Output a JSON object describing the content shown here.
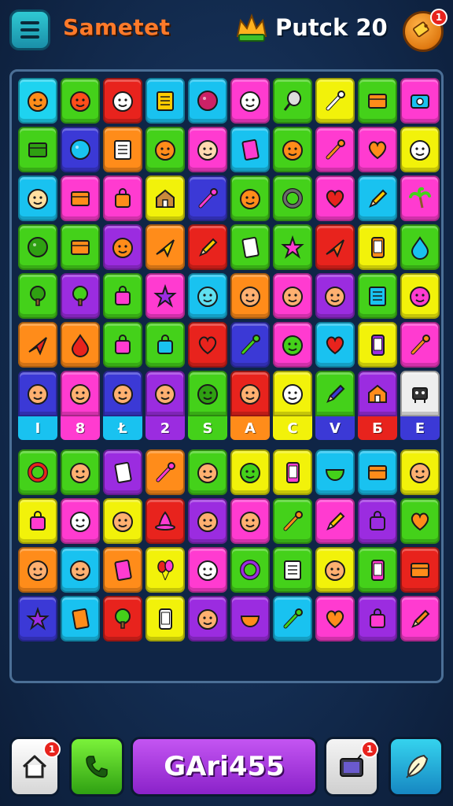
{
  "header": {
    "title": "Sametet",
    "score_label": "Putck 20",
    "notification_count": "1"
  },
  "board": {
    "rows": [
      [
        {
          "bg": "#1ed3f0",
          "icon": "face-icon",
          "fg": "#ff8c1a"
        },
        {
          "bg": "#44d11a",
          "icon": "face-icon",
          "fg": "#ff4d1a"
        },
        {
          "bg": "#e8231d",
          "icon": "face-icon",
          "fg": "#ffffff"
        },
        {
          "bg": "#19c2f0",
          "icon": "notebook-icon",
          "fg": "#ffcc00"
        },
        {
          "bg": "#19c2f0",
          "icon": "ball-icon",
          "fg": "#cc2266"
        },
        {
          "bg": "#ff3bd0",
          "icon": "face-icon",
          "fg": "#ffffff"
        },
        {
          "bg": "#44d11a",
          "icon": "racket-icon",
          "fg": "#dddddd"
        },
        {
          "bg": "#f2f20a",
          "icon": "tool-icon",
          "fg": "#ffffff"
        },
        {
          "bg": "#44d11a",
          "icon": "box-icon",
          "fg": "#ff8c1a"
        },
        {
          "bg": "#ff3bd0",
          "icon": "camera-icon",
          "fg": "#19c2f0"
        }
      ],
      [
        {
          "bg": "#44d11a",
          "icon": "box-icon",
          "fg": "#2fa012"
        },
        {
          "bg": "#3b39d6",
          "icon": "ball-icon",
          "fg": "#19c2f0"
        },
        {
          "bg": "#ff8c1a",
          "icon": "notebook-icon",
          "fg": "#ffffff"
        },
        {
          "bg": "#44d11a",
          "icon": "face-icon",
          "fg": "#ff8c1a"
        },
        {
          "bg": "#ff3bd0",
          "icon": "face-icon",
          "fg": "#ffd9b0"
        },
        {
          "bg": "#19c2f0",
          "icon": "card-icon",
          "fg": "#ff3bd0"
        },
        {
          "bg": "#44d11a",
          "icon": "face-icon",
          "fg": "#ff8c1a"
        },
        {
          "bg": "#ff3bd0",
          "icon": "tool-icon",
          "fg": "#ff8c1a"
        },
        {
          "bg": "#ff3bd0",
          "icon": "heart-icon",
          "fg": "#ff8c1a"
        },
        {
          "bg": "#f2f20a",
          "icon": "face-icon",
          "fg": "#ffffff"
        }
      ],
      [
        {
          "bg": "#19c2f0",
          "icon": "face-icon",
          "fg": "#ffe0a0"
        },
        {
          "bg": "#ff3bd0",
          "icon": "box-icon",
          "fg": "#ff8c1a"
        },
        {
          "bg": "#ff3bd0",
          "icon": "bag-icon",
          "fg": "#ff8c1a"
        },
        {
          "bg": "#f2f20a",
          "icon": "house-icon",
          "fg": "#c98a3c"
        },
        {
          "bg": "#3b39d6",
          "icon": "tool-icon",
          "fg": "#ff3bd0"
        },
        {
          "bg": "#44d11a",
          "icon": "face-icon",
          "fg": "#ff8c1a"
        },
        {
          "bg": "#44d11a",
          "icon": "ring-icon",
          "fg": "#6b6b6b"
        },
        {
          "bg": "#ff3bd0",
          "icon": "heart-icon",
          "fg": "#e8231d"
        },
        {
          "bg": "#19c2f0",
          "icon": "pencil-icon",
          "fg": "#ffcc00"
        },
        {
          "bg": "#ff3bd0",
          "icon": "palm-icon",
          "fg": "#44d11a"
        }
      ],
      [
        {
          "bg": "#44d11a",
          "icon": "ball-icon",
          "fg": "#2fa012"
        },
        {
          "bg": "#44d11a",
          "icon": "box-icon",
          "fg": "#ff8c1a"
        },
        {
          "bg": "#9b2ce0",
          "icon": "face-icon",
          "fg": "#ff8c1a"
        },
        {
          "bg": "#ff8c1a",
          "icon": "plane-icon",
          "fg": "#ffcc00"
        },
        {
          "bg": "#e8231d",
          "icon": "pencil-icon",
          "fg": "#ffcc00"
        },
        {
          "bg": "#44d11a",
          "icon": "card-icon",
          "fg": "#ffffff"
        },
        {
          "bg": "#44d11a",
          "icon": "star-icon",
          "fg": "#ff3bd0"
        },
        {
          "bg": "#e8231d",
          "icon": "plane-icon",
          "fg": "#ff6a1a"
        },
        {
          "bg": "#f2f20a",
          "icon": "phone-icon",
          "fg": "#ff8c1a"
        },
        {
          "bg": "#44d11a",
          "icon": "drop-icon",
          "fg": "#19c2f0"
        }
      ],
      [
        {
          "bg": "#44d11a",
          "icon": "tree-icon",
          "fg": "#2fa012"
        },
        {
          "bg": "#9b2ce0",
          "icon": "tree-icon",
          "fg": "#44d11a"
        },
        {
          "bg": "#44d11a",
          "icon": "bag-icon",
          "fg": "#ff3bd0"
        },
        {
          "bg": "#ff3bd0",
          "icon": "star-icon",
          "fg": "#9b2ce0"
        },
        {
          "bg": "#19c2f0",
          "icon": "face-icon",
          "fg": "#5fe0f0"
        },
        {
          "bg": "#ff8c1a",
          "icon": "face-icon",
          "fg": "#ffb070"
        },
        {
          "bg": "#ff3bd0",
          "icon": "face-icon",
          "fg": "#ffb070"
        },
        {
          "bg": "#9b2ce0",
          "icon": "face-icon",
          "fg": "#ffb070"
        },
        {
          "bg": "#44d11a",
          "icon": "notebook-icon",
          "fg": "#19c2f0"
        },
        {
          "bg": "#f2f20a",
          "icon": "face-icon",
          "fg": "#ff3bd0"
        }
      ],
      [
        {
          "bg": "#ff8c1a",
          "icon": "plane-icon",
          "fg": "#e8231d"
        },
        {
          "bg": "#ff8c1a",
          "icon": "drop-icon",
          "fg": "#e8231d"
        },
        {
          "bg": "#44d11a",
          "icon": "bag-icon",
          "fg": "#ff3bd0"
        },
        {
          "bg": "#44d11a",
          "icon": "bag-icon",
          "fg": "#19c2f0"
        },
        {
          "bg": "#e8231d",
          "icon": "heart-icon",
          "fg": "#e8231d"
        },
        {
          "bg": "#3b39d6",
          "icon": "tool-icon",
          "fg": "#44d11a"
        },
        {
          "bg": "#ff3bd0",
          "icon": "face-icon",
          "fg": "#44d11a"
        },
        {
          "bg": "#19c2f0",
          "icon": "heart-icon",
          "fg": "#e8231d"
        },
        {
          "bg": "#f2f20a",
          "icon": "phone-icon",
          "fg": "#9b2ce0"
        },
        {
          "bg": "#ff3bd0",
          "icon": "tool-icon",
          "fg": "#ff8c1a"
        }
      ],
      [
        {
          "bg": "#3b39d6",
          "icon": "face-icon",
          "fg": "#ffb070"
        },
        {
          "bg": "#ff3bd0",
          "icon": "face-icon",
          "fg": "#ffb070"
        },
        {
          "bg": "#3b39d6",
          "icon": "face-icon",
          "fg": "#ffb070"
        },
        {
          "bg": "#9b2ce0",
          "icon": "face-icon",
          "fg": "#ffb070"
        },
        {
          "bg": "#44d11a",
          "icon": "face-icon",
          "fg": "#2fa012"
        },
        {
          "bg": "#e8231d",
          "icon": "face-icon",
          "fg": "#ffb070"
        },
        {
          "bg": "#f2f20a",
          "icon": "face-icon",
          "fg": "#ffffff"
        },
        {
          "bg": "#44d11a",
          "icon": "pencil-icon",
          "fg": "#3b39d6"
        },
        {
          "bg": "#9b2ce0",
          "icon": "house-icon",
          "fg": "#ff8c1a"
        },
        {
          "bg": "#eeeeee",
          "icon": "robot-icon",
          "fg": "#333333"
        }
      ],
      [
        {
          "bg": "#44d11a",
          "icon": "ring-icon",
          "fg": "#e8231d"
        },
        {
          "bg": "#44d11a",
          "icon": "face-icon",
          "fg": "#ffb070"
        },
        {
          "bg": "#9b2ce0",
          "icon": "card-icon",
          "fg": "#ffffff"
        },
        {
          "bg": "#ff8c1a",
          "icon": "tool-icon",
          "fg": "#ff3bd0"
        },
        {
          "bg": "#44d11a",
          "icon": "face-icon",
          "fg": "#ffb070"
        },
        {
          "bg": "#f2f20a",
          "icon": "face-icon",
          "fg": "#44d11a"
        },
        {
          "bg": "#f2f20a",
          "icon": "phone-icon",
          "fg": "#ff3bd0"
        },
        {
          "bg": "#19c2f0",
          "icon": "bowl-icon",
          "fg": "#44d11a"
        },
        {
          "bg": "#19c2f0",
          "icon": "box-icon",
          "fg": "#ff8c1a"
        },
        {
          "bg": "#f2f20a",
          "icon": "face-icon",
          "fg": "#ffb070"
        }
      ],
      [
        {
          "bg": "#f2f20a",
          "icon": "bag-icon",
          "fg": "#ff3bd0"
        },
        {
          "bg": "#ff3bd0",
          "icon": "face-icon",
          "fg": "#ffffff"
        },
        {
          "bg": "#f2f20a",
          "icon": "face-icon",
          "fg": "#ffb070"
        },
        {
          "bg": "#e8231d",
          "icon": "hat-icon",
          "fg": "#ff3bd0"
        },
        {
          "bg": "#9b2ce0",
          "icon": "face-icon",
          "fg": "#ffb070"
        },
        {
          "bg": "#ff3bd0",
          "icon": "face-icon",
          "fg": "#ffb070"
        },
        {
          "bg": "#44d11a",
          "icon": "tool-icon",
          "fg": "#ff8c1a"
        },
        {
          "bg": "#ff3bd0",
          "icon": "pencil-icon",
          "fg": "#ffcc00"
        },
        {
          "bg": "#9b2ce0",
          "icon": "bag-icon",
          "fg": "#9b2ce0"
        },
        {
          "bg": "#44d11a",
          "icon": "heart-icon",
          "fg": "#ff8c1a"
        }
      ],
      [
        {
          "bg": "#ff8c1a",
          "icon": "face-icon",
          "fg": "#ffb070"
        },
        {
          "bg": "#19c2f0",
          "icon": "face-icon",
          "fg": "#ffb070"
        },
        {
          "bg": "#ff8c1a",
          "icon": "card-icon",
          "fg": "#ff3bd0"
        },
        {
          "bg": "#f2f20a",
          "icon": "balloon-icon",
          "fg": "#e8231d"
        },
        {
          "bg": "#ff3bd0",
          "icon": "face-icon",
          "fg": "#ffffff"
        },
        {
          "bg": "#44d11a",
          "icon": "ring-icon",
          "fg": "#9b2ce0"
        },
        {
          "bg": "#44d11a",
          "icon": "notebook-icon",
          "fg": "#ffffff"
        },
        {
          "bg": "#f2f20a",
          "icon": "face-icon",
          "fg": "#ffb070"
        },
        {
          "bg": "#44d11a",
          "icon": "phone-icon",
          "fg": "#ff3bd0"
        },
        {
          "bg": "#e8231d",
          "icon": "box-icon",
          "fg": "#ff8c1a"
        }
      ],
      [
        {
          "bg": "#3b39d6",
          "icon": "star-icon",
          "fg": "#9b2ce0"
        },
        {
          "bg": "#19c2f0",
          "icon": "card-icon",
          "fg": "#ff8c1a"
        },
        {
          "bg": "#e8231d",
          "icon": "tree-icon",
          "fg": "#44d11a"
        },
        {
          "bg": "#f2f20a",
          "icon": "phone-icon",
          "fg": "#ffffff"
        },
        {
          "bg": "#9b2ce0",
          "icon": "face-icon",
          "fg": "#ffb070"
        },
        {
          "bg": "#9b2ce0",
          "icon": "bowl-icon",
          "fg": "#ff8c1a"
        },
        {
          "bg": "#19c2f0",
          "icon": "tool-icon",
          "fg": "#44d11a"
        },
        {
          "bg": "#ff3bd0",
          "icon": "heart-icon",
          "fg": "#ff8c1a"
        },
        {
          "bg": "#9b2ce0",
          "icon": "bag-icon",
          "fg": "#ff3bd0"
        },
        {
          "bg": "#ff3bd0",
          "icon": "pencil-icon",
          "fg": "#ff8c1a"
        }
      ]
    ],
    "letters": [
      {
        "text": "I",
        "bg": "#19c2f0"
      },
      {
        "text": "8",
        "bg": "#ff3bd0"
      },
      {
        "text": "Ł",
        "bg": "#19c2f0"
      },
      {
        "text": "2",
        "bg": "#9b2ce0"
      },
      {
        "text": "S",
        "bg": "#44d11a"
      },
      {
        "text": "A",
        "bg": "#ff8c1a"
      },
      {
        "text": "C",
        "bg": "#f2f20a"
      },
      {
        "text": "V",
        "bg": "#3b39d6"
      },
      {
        "text": "Ƃ",
        "bg": "#e8231d"
      },
      {
        "text": "E",
        "bg": "#3b39d6"
      }
    ]
  },
  "footer": {
    "play_label": "GAri455",
    "home_badge": "1",
    "tv_badge": "1"
  }
}
